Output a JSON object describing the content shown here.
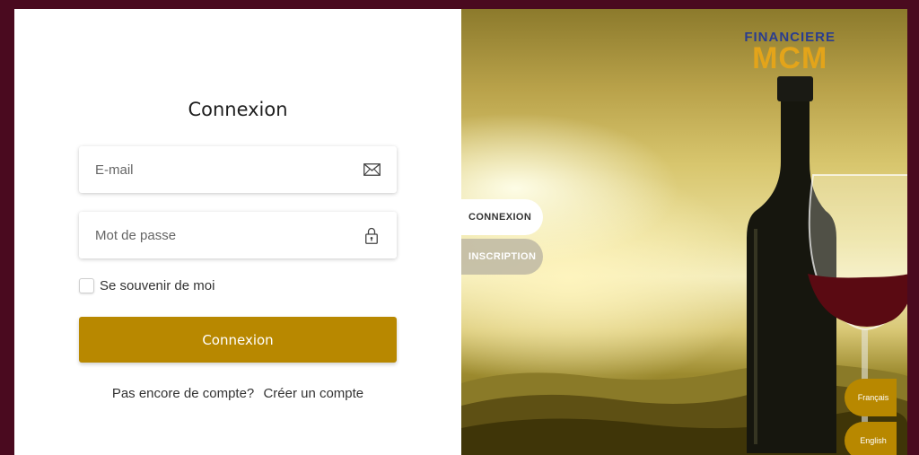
{
  "login": {
    "title": "Connexion",
    "email_placeholder": "E-mail",
    "password_placeholder": "Mot de passe",
    "remember_label": "Se souvenir de moi",
    "submit_label": "Connexion",
    "no_account_text": "Pas encore de compte?",
    "create_account_link": "Créer un compte"
  },
  "brand": {
    "logo_top": "FINANCIERE",
    "logo_bottom": "MCM"
  },
  "tabs": {
    "connexion": "CONNEXION",
    "inscription": "INSCRIPTION"
  },
  "languages": {
    "french": "Français",
    "english": "English"
  },
  "icons": {
    "email": "envelope-icon",
    "password": "lock-icon"
  },
  "colors": {
    "accent": "#b88800",
    "frame": "#4a0a1f"
  }
}
